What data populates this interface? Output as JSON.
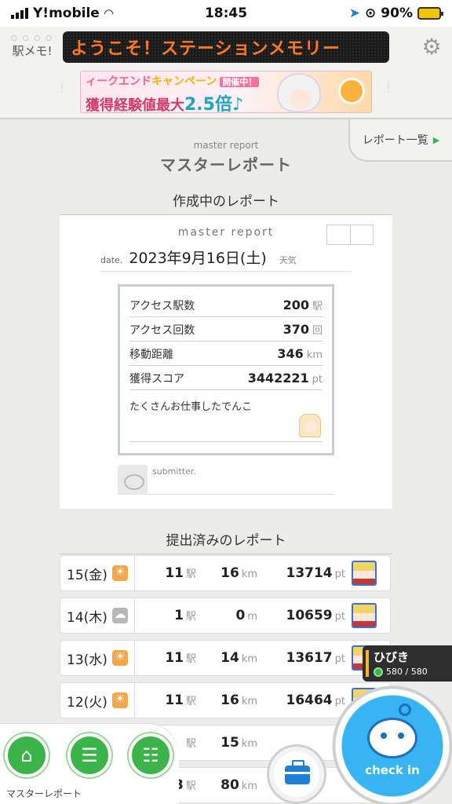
{
  "status_bar": {
    "carrier": "Y!mobile",
    "time": "18:45",
    "battery_percent": "90%"
  },
  "header": {
    "logo_text": "駅メモ!",
    "marquee_text": "ようこそ！ステーションメモリー",
    "banner": {
      "line1_prefix": "ィークエンド",
      "line1_campaign": "キャンペーン",
      "line1_badge": "開催中！",
      "line2_text": "獲得経験値最大",
      "line2_value": "2.5倍♪"
    }
  },
  "report_list_link": "レポート一覧",
  "page": {
    "subtitle": "master report",
    "title": "マスターレポート"
  },
  "current_report": {
    "heading": "作成中のレポート",
    "card_label": "master report",
    "date_label": "date.",
    "date": "2023年9月16日(土)",
    "weather_label": "天気",
    "stats": [
      {
        "label": "アクセス駅数",
        "value": "200",
        "unit": "駅"
      },
      {
        "label": "アクセス回数",
        "value": "370",
        "unit": "回"
      },
      {
        "label": "移動距離",
        "value": "346",
        "unit": "km"
      },
      {
        "label": "獲得スコア",
        "value": "3442221",
        "unit": "pt"
      }
    ],
    "comment": "たくさんお仕事したでんこ",
    "submitter_label": "submitter."
  },
  "submitted": {
    "heading": "提出済みのレポート",
    "rows": [
      {
        "day": "15(金)",
        "weather": "sun",
        "stations": "11",
        "station_unit": "駅",
        "distance": "16",
        "distance_unit": "km",
        "score": "13714",
        "score_unit": "pt"
      },
      {
        "day": "14(木)",
        "weather": "cloud",
        "stations": "1",
        "station_unit": "駅",
        "distance": "0",
        "distance_unit": "m",
        "score": "10659",
        "score_unit": "pt"
      },
      {
        "day": "13(水)",
        "weather": "sun",
        "stations": "11",
        "station_unit": "駅",
        "distance": "14",
        "distance_unit": "km",
        "score": "13617",
        "score_unit": "pt"
      },
      {
        "day": "12(火)",
        "weather": "sun",
        "stations": "11",
        "station_unit": "駅",
        "distance": "16",
        "distance_unit": "km",
        "score": "16464",
        "score_unit": "pt"
      },
      {
        "day": "",
        "weather": "",
        "stations": "",
        "station_unit": "駅",
        "distance": "15",
        "distance_unit": "km",
        "score": "",
        "score_unit": ""
      },
      {
        "day": "",
        "weather": "",
        "stations": "43",
        "station_unit": "駅",
        "distance": "80",
        "distance_unit": "km",
        "score": "",
        "score_unit": ""
      }
    ]
  },
  "character_popup": {
    "name": "ひびき",
    "hp": "580 / 580"
  },
  "bottom_nav": {
    "label": "マスターレポート",
    "buttons": [
      "home-icon",
      "report-icon",
      "train-list-icon"
    ]
  },
  "checkin_label": "check in",
  "colors": {
    "accent_green": "#3bb54a",
    "checkin_blue": "#37b4f2",
    "marquee_orange": "#ff7a1a"
  }
}
